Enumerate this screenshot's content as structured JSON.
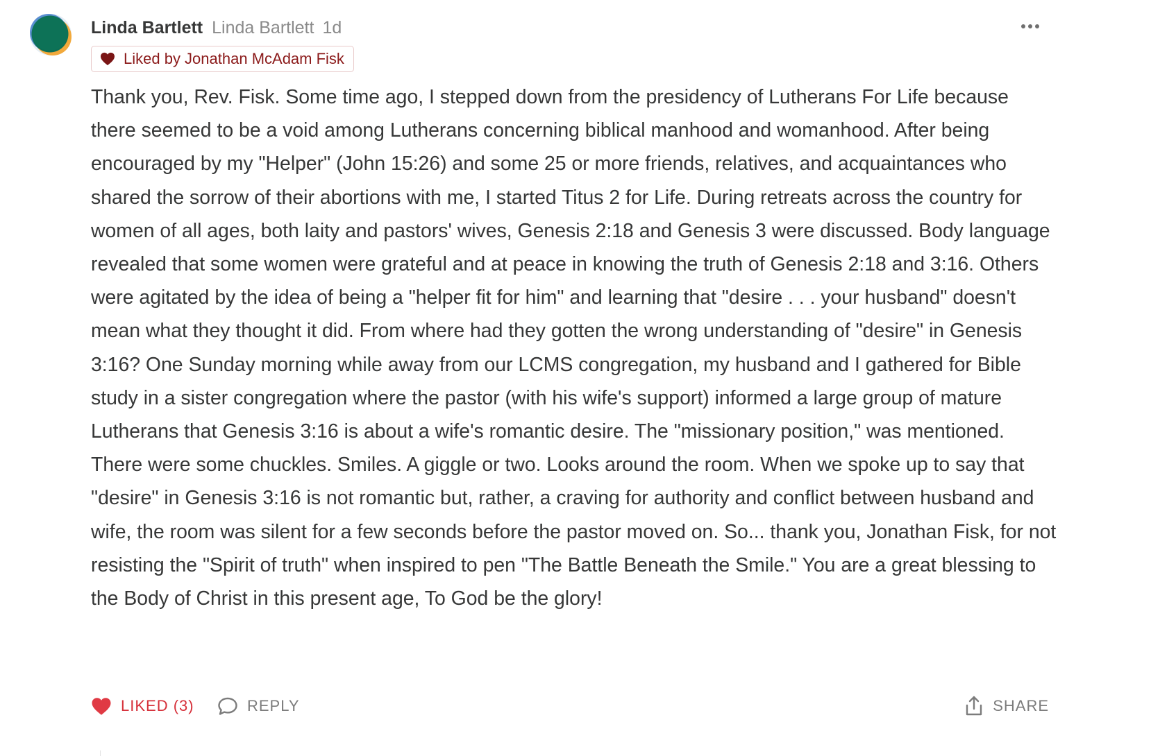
{
  "comment": {
    "author_name": "Linda Bartlett",
    "author_handle": "Linda Bartlett",
    "timestamp": "1d",
    "liked_by_text": "Liked by Jonathan McAdam Fisk",
    "body": "Thank you, Rev. Fisk. Some time ago, I stepped down from the presidency of Lutherans For Life because there seemed to be a void among Lutherans concerning biblical manhood and womanhood. After being encouraged by my \"Helper\" (John 15:26) and some 25 or more friends, relatives, and acquaintances who shared the sorrow of their abortions with me, I started Titus 2 for Life. During retreats across the country for women of all ages, both laity and pastors' wives, Genesis 2:18 and Genesis 3 were discussed. Body language revealed that some women were grateful and at peace in knowing the truth of Genesis 2:18 and 3:16. Others were agitated by the idea of being a \"helper fit for him\" and learning that \"desire . . . your husband\" doesn't mean what they thought it did. From where had they gotten the wrong understanding of \"desire\" in Genesis 3:16? One Sunday morning while away from our LCMS congregation, my husband and I gathered for Bible study in a sister congregation where the pastor (with his wife's support) informed a large group of mature Lutherans that Genesis 3:16 is about a wife's romantic desire. The \"missionary position,\" was mentioned. There were some chuckles. Smiles. A giggle or two. Looks around the room. When we spoke up to say that \"desire\" in Genesis 3:16 is not romantic but, rather, a craving for authority and conflict between husband and wife, the room was silent for a few seconds before the pastor moved on. So... thank you, Jonathan Fisk, for not resisting the \"Spirit of truth\" when inspired to pen \"The Battle Beneath the Smile.\" You are a great blessing to the Body of Christ in this present age, To God be the glory!"
  },
  "actions": {
    "like_label": "LIKED (3)",
    "reply_label": "REPLY",
    "share_label": "SHARE"
  },
  "icons": {
    "avatar": "avatar-circle",
    "more": "more-horizontal-icon",
    "badge_heart": "heart-icon",
    "like": "heart-filled-icon",
    "reply": "speech-bubble-icon",
    "share": "share-upload-icon"
  },
  "colors": {
    "text": "#363737",
    "muted": "#8a8a8a",
    "liked_red": "#d6303a",
    "badge_text": "#8b1a1a",
    "badge_border": "#e8c9c9",
    "avatar_green": "#0c6e55",
    "avatar_orange": "#f2a93b",
    "avatar_blue": "#5b8fd1"
  }
}
